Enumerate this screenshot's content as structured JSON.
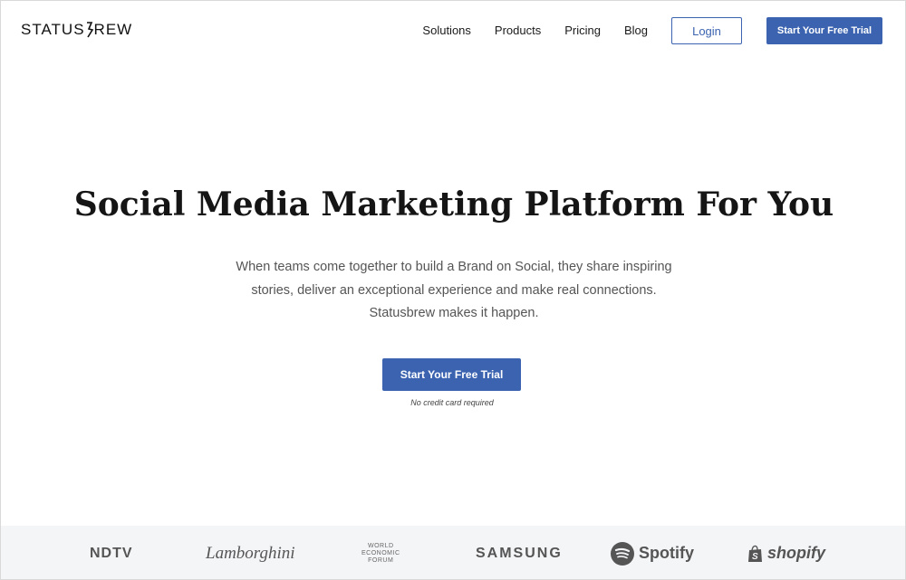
{
  "header": {
    "logo_text_left": "STATUS",
    "logo_text_right": "REW",
    "nav": [
      "Solutions",
      "Products",
      "Pricing",
      "Blog"
    ],
    "login_label": "Login",
    "trial_label": "Start Your Free Trial"
  },
  "hero": {
    "title": "Social Media Marketing Platform For You",
    "text_line1": "When teams come together to build a Brand on Social, they share inspiring",
    "text_line2": "stories, deliver an exceptional experience and make real connections.",
    "text_line3": "Statusbrew makes it happen.",
    "cta_label": "Start Your Free Trial",
    "note": "No credit card required"
  },
  "brands": {
    "ndtv": "NDTV",
    "lamborghini": "Lamborghini",
    "wef_line1": "WORLD",
    "wef_line2": "ECONOMIC",
    "wef_line3": "FORUM",
    "samsung": "SAMSUNG",
    "spotify": "Spotify",
    "shopify": "shopify"
  },
  "colors": {
    "accent": "#3b63b0",
    "logo_strip_bg": "#f4f5f7"
  }
}
